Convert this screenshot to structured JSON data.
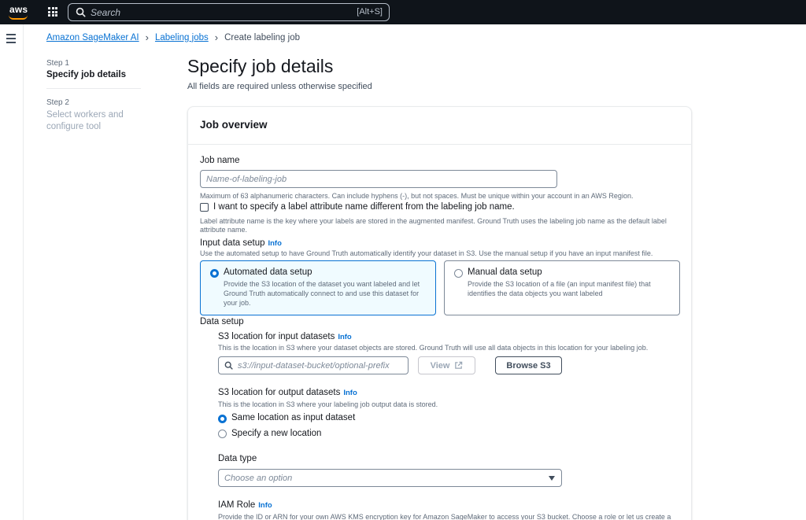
{
  "topnav": {
    "logo_text": "aws",
    "search_placeholder": "Search",
    "search_shortcut": "[Alt+S]"
  },
  "breadcrumb": {
    "items": [
      "Amazon SageMaker AI",
      "Labeling jobs",
      "Create labeling job"
    ]
  },
  "steps": [
    {
      "num": "Step 1",
      "title": "Specify job details",
      "active": true
    },
    {
      "num": "Step 2",
      "title": "Select workers and configure tool",
      "active": false
    }
  ],
  "header": {
    "title": "Specify job details",
    "subtitle": "All fields are required unless otherwise specified"
  },
  "job_overview": {
    "title": "Job overview",
    "job_name": {
      "label": "Job name",
      "placeholder": "Name-of-labeling-job",
      "hint": "Maximum of 63 alphanumeric characters. Can include hyphens (-), but not spaces. Must be unique within your account in an AWS Region."
    },
    "label_attr": {
      "checkbox_label": "I want to specify a label attribute name different from the labeling job name.",
      "hint": "Label attribute name is the key where your labels are stored in the augmented manifest. Ground Truth uses the labeling job name as the default label attribute name."
    },
    "input_setup": {
      "label": "Input data setup",
      "info": "Info",
      "hint": "Use the automated setup to have Ground Truth automatically identify your dataset in S3. Use the manual setup if you have an input manifest file.",
      "options": [
        {
          "title": "Automated data setup",
          "desc": "Provide the S3 location of the dataset you want labeled and let Ground Truth automatically connect to and use this dataset for your job.",
          "selected": true
        },
        {
          "title": "Manual data setup",
          "desc": "Provide the S3 location of a file (an input manifest file) that identifies the data objects you want labeled",
          "selected": false
        }
      ]
    },
    "data_setup": {
      "label": "Data setup",
      "s3_input": {
        "label": "S3 location for input datasets",
        "info": "Info",
        "hint": "This is the location in S3 where your dataset objects are stored. Ground Truth will use all data objects in this location for your labeling job.",
        "placeholder": "s3://input-dataset-bucket/optional-prefix",
        "view_button": "View",
        "browse_button": "Browse S3"
      },
      "s3_output": {
        "label": "S3 location for output datasets",
        "info": "Info",
        "hint": "This is the location in S3 where your labeling job output data is stored.",
        "options": [
          {
            "label": "Same location as input dataset",
            "selected": true
          },
          {
            "label": "Specify a new location",
            "selected": false
          }
        ]
      },
      "data_type": {
        "label": "Data type",
        "placeholder": "Choose an option"
      },
      "iam_role": {
        "label": "IAM Role",
        "info": "Info",
        "hint": "Provide the ID or ARN for your own AWS KMS encryption key for Amazon SageMaker to access your S3 bucket. Choose a role or let us create a"
      }
    }
  }
}
